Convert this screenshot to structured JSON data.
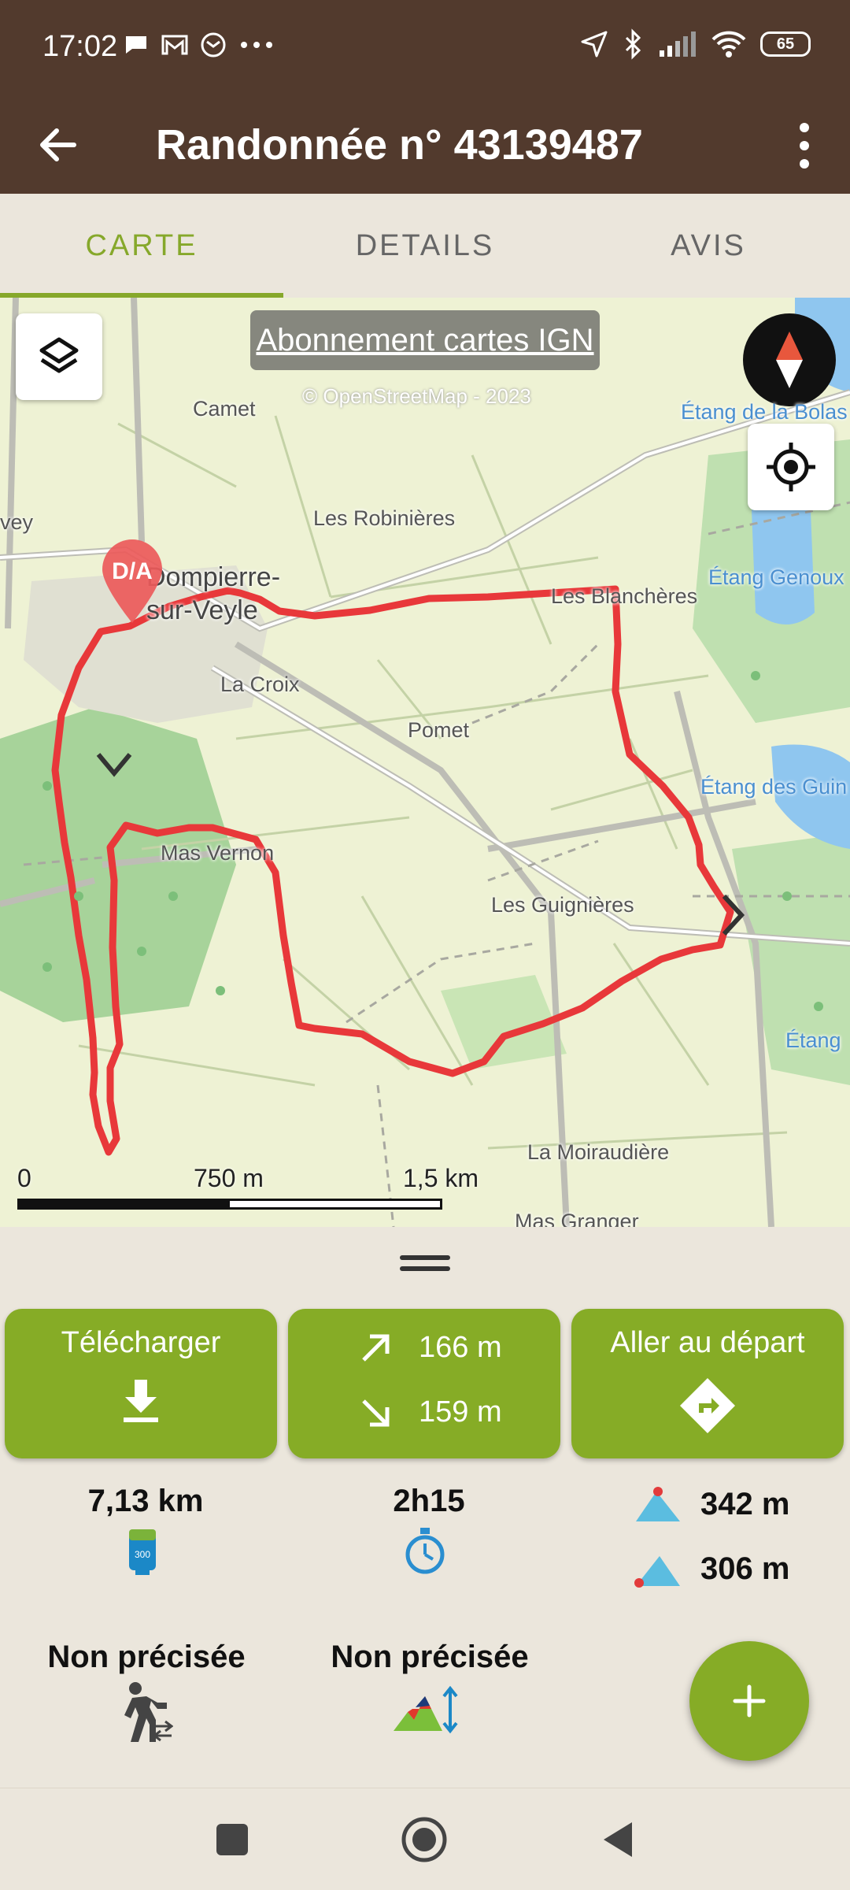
{
  "status_bar": {
    "time": "17:02",
    "battery": "65",
    "left_icons": [
      "chat-icon",
      "gmail-icon",
      "mail-icon",
      "more-dots-icon"
    ],
    "right_icons": [
      "location-arrow-icon",
      "bluetooth-icon",
      "signal-icon",
      "wifi-icon",
      "battery-icon"
    ]
  },
  "app_bar": {
    "title": "Randonnée n° 43139487"
  },
  "tabs": [
    {
      "label": "CARTE",
      "active": true
    },
    {
      "label": "DETAILS",
      "active": false
    },
    {
      "label": "AVIS",
      "active": false
    }
  ],
  "map": {
    "ign_banner": "Abonnement cartes IGN",
    "osm_credit": "© OpenStreetMap - 2023",
    "marker_label": "D/A",
    "places": {
      "camet": "Camet",
      "robinieres": "Les Robinières",
      "dompierre_1": "Dompierre-",
      "dompierre_2": "sur-Veyle",
      "la_croix": "La Croix",
      "pomet": "Pomet",
      "blancheres": "Les Blanchères",
      "mas_vernon": "Mas Vernon",
      "guignieres": "Les Guignières",
      "moiraudiere": "La Moiraudière",
      "mas_granger": "Mas Granger",
      "vey": "vey",
      "etang_bolas": "Étang de la Bolas",
      "etang_genoux": "Étang Genoux",
      "etang_guin": "Étang des Guin",
      "etang": "Étang"
    },
    "scale": {
      "zero": "0",
      "mid": "750 m",
      "max": "1,5 km"
    },
    "colors": {
      "route": "#e8383a",
      "water": "#8fc6ef",
      "forest": "#a8d49a"
    }
  },
  "sheet": {
    "download": {
      "label": "Télécharger"
    },
    "elevation": {
      "ascent": "166 m",
      "descent": "159 m"
    },
    "go_to_start": {
      "label": "Aller au départ"
    },
    "distance": "7,13 km",
    "duration": "2h15",
    "max_altitude": "342 m",
    "min_altitude": "306 m",
    "activity_level": "Non précisée",
    "difficulty": "Non précisée"
  },
  "accent_color": "#86ac26",
  "header_color": "#523a2d"
}
